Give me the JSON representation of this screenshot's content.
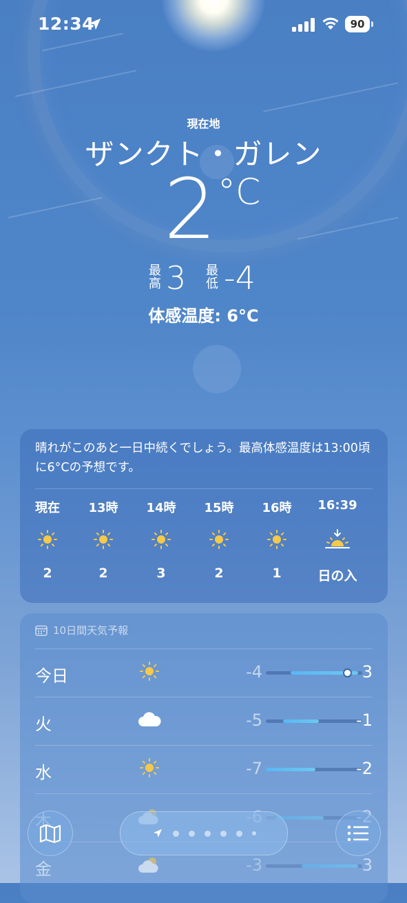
{
  "status_bar": {
    "time": "12:34",
    "battery": "90",
    "icons": [
      "location-arrow-icon",
      "cellular-signal-icon",
      "wifi-icon",
      "battery-icon"
    ]
  },
  "header": {
    "location_label": "現在地",
    "city": "ザンクト・ガレン",
    "temperature": "2",
    "unit": "°C",
    "high_label_1": "最",
    "high_label_2": "高",
    "high": "3",
    "low_label_1": "最",
    "low_label_2": "低",
    "low": "-4",
    "feels_like": "体感温度: 6°C"
  },
  "hourly": {
    "summary": "晴れがこのあと一日中続くでしょう。最高体感温度は13:00頃に6°Cの予想です。",
    "items": [
      {
        "label": "現在",
        "icon": "sun-icon",
        "value": "2"
      },
      {
        "label": "13時",
        "icon": "sun-icon",
        "value": "2"
      },
      {
        "label": "14時",
        "icon": "sun-icon",
        "value": "3"
      },
      {
        "label": "15時",
        "icon": "sun-icon",
        "value": "2"
      },
      {
        "label": "16時",
        "icon": "sun-icon",
        "value": "1"
      },
      {
        "label": "16:39",
        "icon": "sunset-icon",
        "value": "日の入"
      }
    ]
  },
  "daily": {
    "header": "10日間天気予報",
    "header_icon": "calendar-icon",
    "days": [
      {
        "name": "今日",
        "icon": "sun-icon",
        "low": "-4",
        "high": "3"
      },
      {
        "name": "火",
        "icon": "cloud-icon",
        "low": "-5",
        "high": "-1"
      },
      {
        "name": "水",
        "icon": "sun-icon",
        "low": "-7",
        "high": "-2"
      },
      {
        "name": "木",
        "icon": "partly-cloudy-icon",
        "low": "-6",
        "high": "-2"
      },
      {
        "name": "金",
        "icon": "partly-cloudy-icon",
        "low": "-3",
        "high": "3"
      }
    ]
  },
  "bottom_bar": {
    "map_icon": "map-icon",
    "list_icon": "list-icon",
    "pages": 7
  },
  "colors": {
    "sun": "#f7c948",
    "bar_fill": "#5ab6f4",
    "sky_top": "#4a7fc4",
    "sky_bottom": "#a9c3e6"
  }
}
